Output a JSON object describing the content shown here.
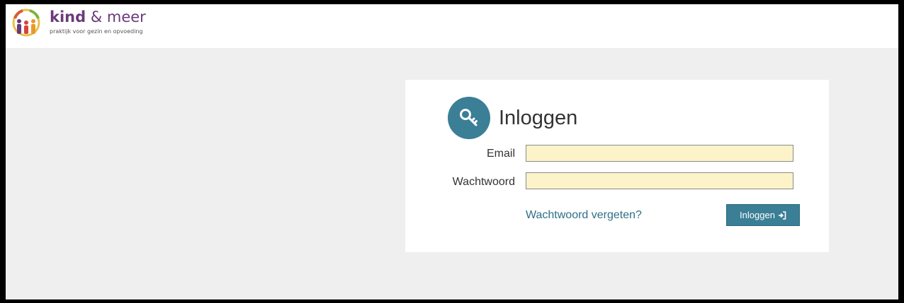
{
  "header": {
    "logo": {
      "title_bold": "kind",
      "title_rest": " & meer",
      "subtitle": "praktijk voor gezin en opvoeding"
    }
  },
  "login": {
    "title": "Inloggen",
    "title_icon": "key-icon",
    "email_label": "Email",
    "email_value": "",
    "password_label": "Wachtwoord",
    "password_value": "",
    "forgot_link": "Wachtwoord vergeten?",
    "submit_label": "Inloggen",
    "submit_icon": "sign-in-icon"
  },
  "colors": {
    "accent": "#3a7f96",
    "input_bg": "#fdf3c8",
    "page_bg": "#efefef",
    "brand_purple": "#6b3a7a"
  }
}
